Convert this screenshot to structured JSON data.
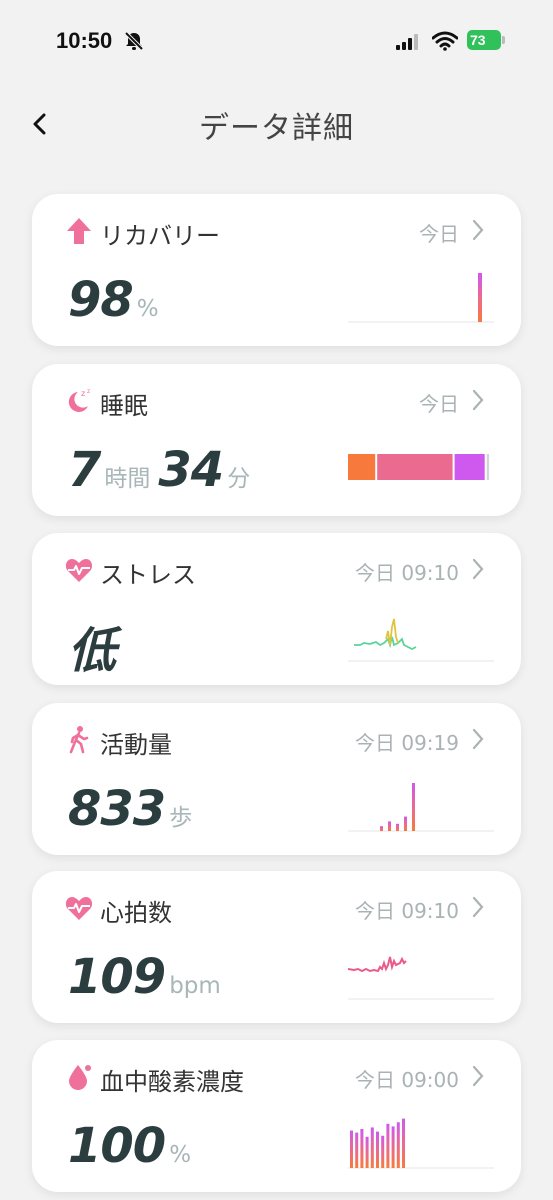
{
  "status_bar": {
    "time": "10:50",
    "battery": "73"
  },
  "header": {
    "title": "データ詳細"
  },
  "colors": {
    "accent_pink": "#f0709c",
    "orange": "#f77a3c",
    "violet": "#cf59ee",
    "green": "#59d49a",
    "value_text": "#2c3d40",
    "muted_text": "#aab3b4"
  },
  "cards": [
    {
      "title": "リカバリー",
      "date": "今日",
      "icon": "arrow-up-icon",
      "value": "98",
      "unit": "%",
      "chart_level": 0.98
    },
    {
      "title": "睡眠",
      "date": "今日",
      "icon": "moon-sleep-icon",
      "hours": "7",
      "hours_unit": "時間",
      "minutes": "34",
      "minutes_unit": "分",
      "segments": [
        {
          "color": "#f77a3c",
          "fraction": 0.2
        },
        {
          "color": "#ea6a90",
          "fraction": 0.53
        },
        {
          "color": "#cf59ee",
          "fraction": 0.22
        },
        {
          "color": "#d4d4d4",
          "fraction": 0.03
        }
      ]
    },
    {
      "title": "ストレス",
      "date": "今日 09:10",
      "icon": "heart-pulse-icon",
      "value": "低"
    },
    {
      "title": "活動量",
      "date": "今日 09:19",
      "icon": "walking-person-icon",
      "value": "833",
      "unit": "歩",
      "bars": [
        0.1,
        0.2,
        0.15,
        0.3,
        1.0
      ]
    },
    {
      "title": "心拍数",
      "date": "今日 09:10",
      "icon": "heart-pulse-icon",
      "value": "109",
      "unit": "bpm"
    },
    {
      "title": "血中酸素濃度",
      "date": "今日 09:00",
      "icon": "drop-icon",
      "value": "100",
      "unit": "%",
      "bars": [
        0.72,
        0.68,
        0.75,
        0.6,
        0.78,
        0.7,
        0.62,
        0.85,
        0.8,
        0.88,
        0.95
      ]
    }
  ]
}
